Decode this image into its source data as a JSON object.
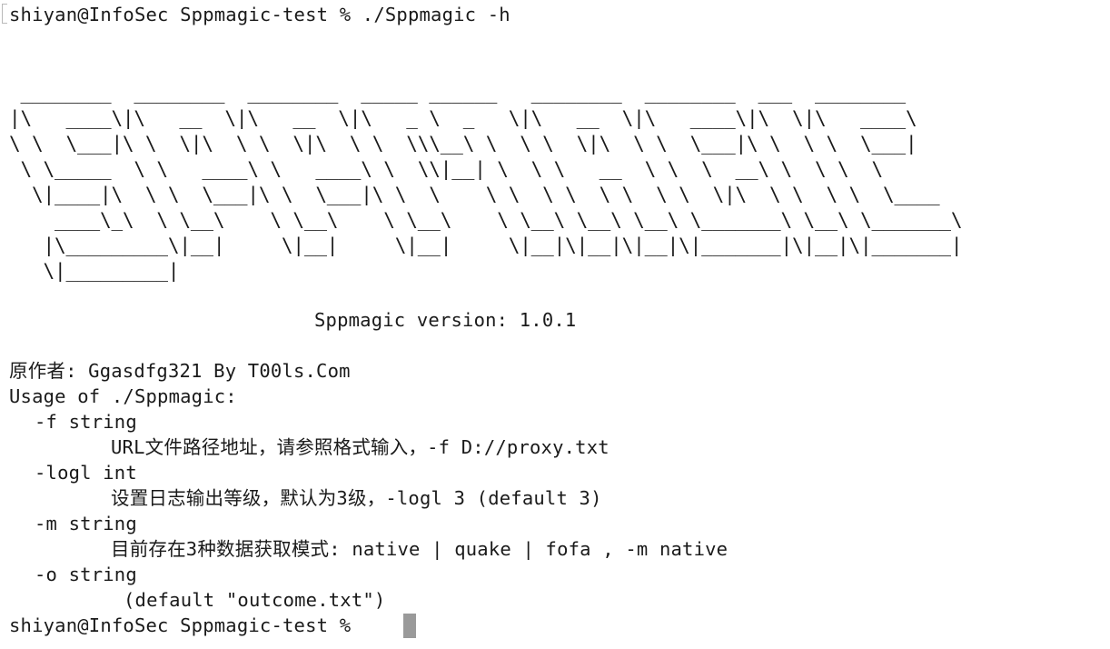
{
  "terminal": {
    "command_line": "shiyan@InfoSec Sppmagic-test % ./Sppmagic -h",
    "banner": " ________  ________  ________  _____ ______   ________  ________  ___  ________\n|\\   ____\\|\\   __  \\|\\   __  \\|\\   _ \\  _   \\|\\   __  \\|\\   ____\\|\\  \\|\\   ____\\\n\\ \\  \\___|\\ \\  \\|\\  \\ \\  \\|\\  \\ \\  \\\\\\__\\ \\  \\ \\  \\|\\  \\ \\  \\___|\\ \\  \\ \\  \\___|\n \\ \\_____  \\ \\   ____\\ \\   ____\\ \\  \\\\|__| \\  \\ \\   __  \\ \\  \\  __\\ \\  \\ \\  \\\n  \\|____|\\  \\ \\  \\___|\\ \\  \\___|\\ \\  \\    \\ \\  \\ \\  \\ \\  \\ \\  \\|\\  \\ \\  \\ \\  \\____\n    ____\\_\\  \\ \\__\\    \\ \\__\\    \\ \\__\\    \\ \\__\\ \\__\\ \\__\\ \\_______\\ \\__\\ \\_______\\\n   |\\_________\\|__|     \\|__|     \\|__|     \\|__|\\|__|\\|__|\\|_______|\\|__|\\|_______|\n   \\|_________|",
    "version_line": "Sppmagic version: 1.0.1",
    "author_line": "原作者: Ggasdfg321 By T00ls.Com",
    "usage_line": "Usage of ./Sppmagic:",
    "options": [
      {
        "flag": "-f string",
        "description": "URL文件路径地址，请参照格式输入，-f D://proxy.txt"
      },
      {
        "flag": "-logl int",
        "description": "设置日志输出等级，默认为3级，-logl 3 (default 3)"
      },
      {
        "flag": "-m string",
        "description": "目前存在3种数据获取模式: native | quake | fofa , -m native"
      },
      {
        "flag": "-o string",
        "description": "(default \"outcome.txt\")"
      }
    ],
    "prompt": "shiyan@InfoSec Sppmagic-test % "
  },
  "colors": {
    "background": "#ffffff",
    "text": "#1a1a1a",
    "cursor": "#9a9a9a"
  }
}
